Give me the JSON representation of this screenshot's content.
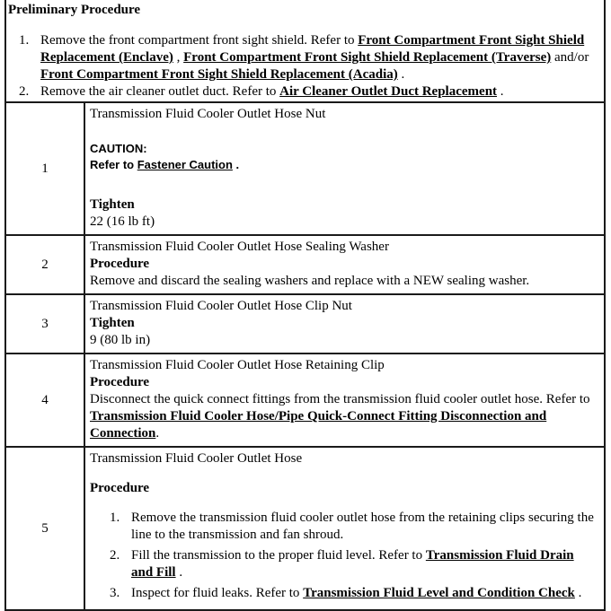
{
  "heading": "Preliminary Procedure",
  "preliminary": {
    "items": [
      {
        "marker": "1.",
        "pre": "Remove the front compartment front sight shield. Refer to ",
        "link1": "Front Compartment Front Sight Shield Replacement (Enclave)",
        "mid1": " , ",
        "link2": "Front Compartment Front Sight Shield Replacement (Traverse)",
        "mid2": " and/or ",
        "link3": "Front Compartment Front Sight Shield Replacement (Acadia)",
        "post": " ."
      },
      {
        "marker": "2.",
        "pre": "Remove the air cleaner outlet duct. Refer to ",
        "link1": "Air Cleaner Outlet Duct Replacement",
        "post": " ."
      }
    ]
  },
  "table": {
    "rows": [
      {
        "number": "1",
        "title": "Transmission Fluid Cooler Outlet Hose Nut",
        "caution_label": "CAUTION:",
        "caution_pre": "Refer to ",
        "caution_link": "Fastener Caution",
        "caution_post": " .",
        "tighten_label": "Tighten",
        "tighten_value": "22 (16 lb ft)"
      },
      {
        "number": "2",
        "title": "Transmission Fluid Cooler Outlet Hose Sealing Washer",
        "procedure_label": "Procedure",
        "procedure_text": "Remove and discard the sealing washers and replace with a NEW sealing washer."
      },
      {
        "number": "3",
        "title": "Transmission Fluid Cooler Outlet Hose Clip Nut",
        "tighten_label": "Tighten",
        "tighten_value": "9 (80 lb in)"
      },
      {
        "number": "4",
        "title": "Transmission Fluid Cooler Outlet Hose Retaining Clip",
        "procedure_label": "Procedure",
        "procedure_pre": "Disconnect the quick connect fittings from the transmission fluid cooler outlet hose. Refer to ",
        "procedure_link": "Transmission Fluid Cooler Hose/Pipe Quick-Connect Fitting Disconnection and Connection",
        "procedure_post": "."
      },
      {
        "number": "5",
        "title": "Transmission Fluid Cooler Outlet Hose",
        "procedure_label": "Procedure",
        "steps": [
          {
            "marker": "1.",
            "pre": "Remove the transmission fluid cooler outlet hose from the retaining clips securing the line to the transmission and fan shroud.",
            "link": "",
            "post": ""
          },
          {
            "marker": "2.",
            "pre": "Fill the transmission to the proper fluid level. Refer to ",
            "link": "Transmission Fluid Drain and Fill",
            "post": " ."
          },
          {
            "marker": "3.",
            "pre": "Inspect for fluid leaks. Refer to ",
            "link": "Transmission Fluid Level and Condition Check",
            "post": " ."
          }
        ]
      }
    ]
  }
}
